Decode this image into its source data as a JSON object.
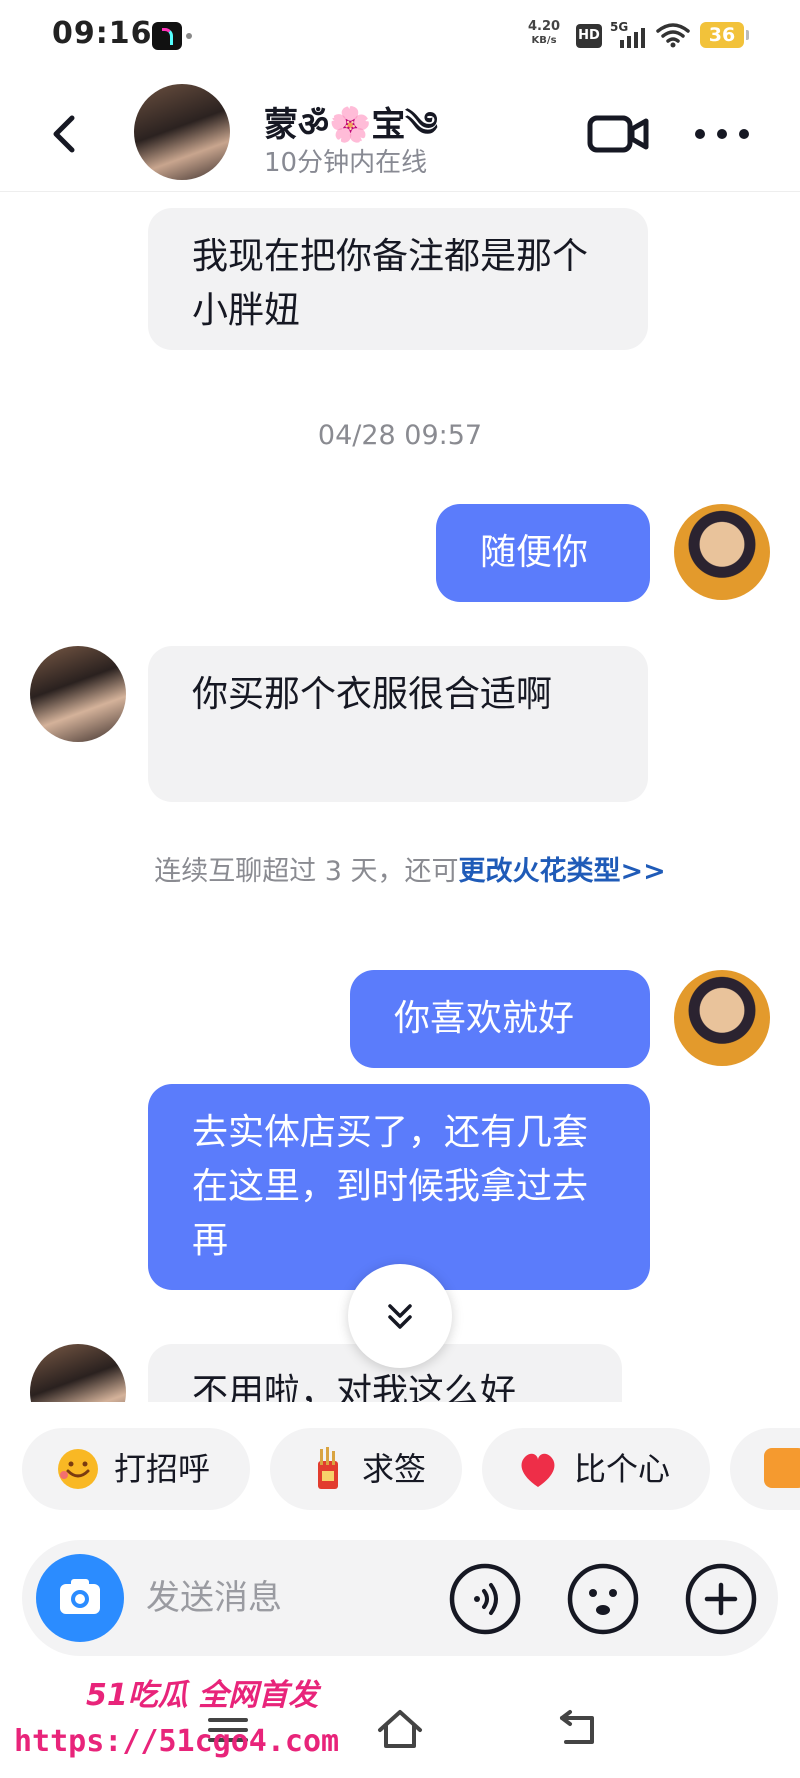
{
  "status_bar": {
    "time": "09:16",
    "net_speed_value": "4.20",
    "net_speed_unit": "KB/s",
    "hd": "HD",
    "network": "5G",
    "battery": "36"
  },
  "header": {
    "name": "蒙ॐ🌸宝༄",
    "status": "10分钟内在线"
  },
  "messages": [
    {
      "side": "in",
      "text": "我现在把你备注都是那个小胖妞"
    },
    {
      "timestamp": "04/28 09:57"
    },
    {
      "side": "out",
      "text": "随便你"
    },
    {
      "side": "in",
      "text": "你买那个衣服很合适啊"
    },
    {
      "notice": "连续互聊超过 3 天，还可",
      "link": "更改火花类型>>"
    },
    {
      "side": "out",
      "text": "你喜欢就好"
    },
    {
      "side": "out",
      "text": "去实体店买了，还有几套在这里，到时候我拿过去再"
    },
    {
      "side": "in",
      "text": "不用啦，对我这么好"
    }
  ],
  "quick_replies": [
    {
      "label": "打招呼",
      "icon": "smile-emoji-icon"
    },
    {
      "label": "求签",
      "icon": "fortune-stick-icon"
    },
    {
      "label": "比个心",
      "icon": "heart-icon"
    }
  ],
  "input": {
    "placeholder": "发送消息"
  },
  "watermark": {
    "line1": "51吃瓜 全网首发",
    "line2": "https://51cgo4.com"
  },
  "colors": {
    "accent": "#5b7cfb",
    "bubble_in": "#f2f2f3",
    "camera": "#2b8cff",
    "link": "#1f5bb8",
    "watermark": "#e8247a"
  }
}
